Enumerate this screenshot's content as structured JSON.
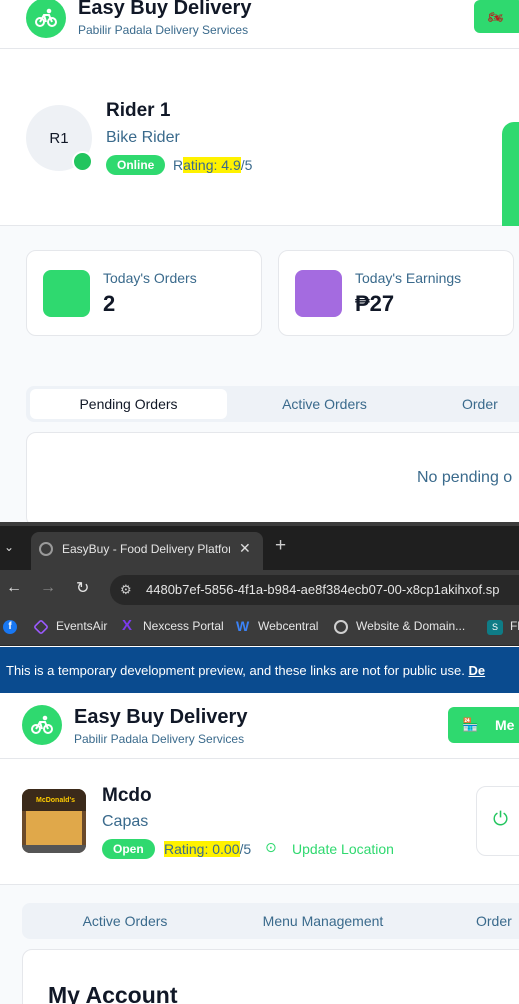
{
  "rider_app": {
    "brand": {
      "title": "Easy Buy Delivery",
      "subtitle": "Pabilir Padala Delivery Services"
    },
    "profile": {
      "avatar_initials": "R1",
      "name": "Rider 1",
      "role": "Bike Rider",
      "status": "Online",
      "rating_label_pre": "R",
      "rating_label_hl": "ating: 4.9",
      "rating_suffix": "/5"
    },
    "stats": [
      {
        "label": "Today's Orders",
        "value": "2",
        "color": "#2fd96f"
      },
      {
        "label": "Today's Earnings",
        "value": "₱27",
        "color": "#a46be0"
      }
    ],
    "tabs": [
      "Pending Orders",
      "Active Orders",
      "Order"
    ],
    "empty_text": "No pending o"
  },
  "browser": {
    "tab_title": "EasyBuy - Food Delivery Platfor",
    "new_tab_glyph": "+",
    "url": "4480b7ef-5856-4f1a-b984-ae8f384ecb07-00-x8cp1akihxof.sp",
    "bookmarks": [
      "EventsAir",
      "Nexcess Portal",
      "Webcentral",
      "Website & Domain...",
      "Fl"
    ],
    "banner_text": "This is a temporary development preview, and these links are not for public use.",
    "banner_link": "De"
  },
  "store_app": {
    "brand": {
      "title": "Easy Buy Delivery",
      "subtitle": "Pabilir Padala Delivery Services"
    },
    "menu_button": "Me",
    "profile": {
      "name": "Mcdo",
      "location": "Capas",
      "status": "Open",
      "rating_label": "Rating: 0.00",
      "rating_suffix": "/5",
      "update_location": "Update Location",
      "store_sign": "McDonald's"
    },
    "tabs": [
      "Active Orders",
      "Menu Management",
      "Order"
    ],
    "account_title": "My Account"
  },
  "colors": {
    "accent": "#2fd96f",
    "text_blue": "#3a6a8c",
    "banner": "#0a4b8f"
  }
}
